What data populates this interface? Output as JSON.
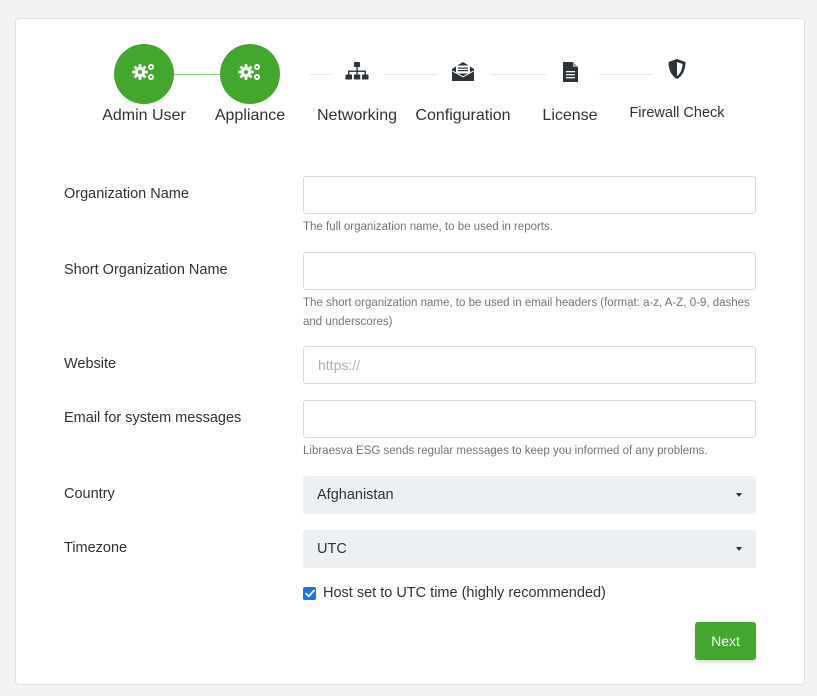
{
  "stepper": {
    "steps": [
      {
        "label": "Admin User",
        "icon": "gears-icon",
        "state": "done"
      },
      {
        "label": "Appliance",
        "icon": "gears-icon",
        "state": "done"
      },
      {
        "label": "Networking",
        "icon": "network-icon",
        "state": "pending"
      },
      {
        "label": "Configuration",
        "icon": "envelope-open-icon",
        "state": "pending"
      },
      {
        "label": "License",
        "icon": "document-icon",
        "state": "pending"
      },
      {
        "label": "Firewall Check",
        "icon": "shield-icon",
        "state": "pending"
      }
    ],
    "colors": {
      "done": "#43a72e",
      "connector_done": "#8fcf7f",
      "connector_pending": "#e4e7ea"
    }
  },
  "form": {
    "org_name": {
      "label": "Organization Name",
      "value": "",
      "help": "The full organization name, to be used in reports."
    },
    "short_org_name": {
      "label": "Short Organization Name",
      "value": "",
      "help": "The short organization name, to be used in email headers (format: a-z, A-Z, 0-9, dashes and underscores)"
    },
    "website": {
      "label": "Website",
      "value": "",
      "placeholder": "https://"
    },
    "email": {
      "label": "Email for system messages",
      "value": "",
      "help": "Libraesva ESG sends regular messages to keep you informed of any problems."
    },
    "country": {
      "label": "Country",
      "selected": "Afghanistan"
    },
    "timezone": {
      "label": "Timezone",
      "selected": "UTC"
    },
    "utc_checkbox": {
      "label": "Host set to UTC time (highly recommended)",
      "checked": true
    }
  },
  "actions": {
    "next_label": "Next"
  }
}
